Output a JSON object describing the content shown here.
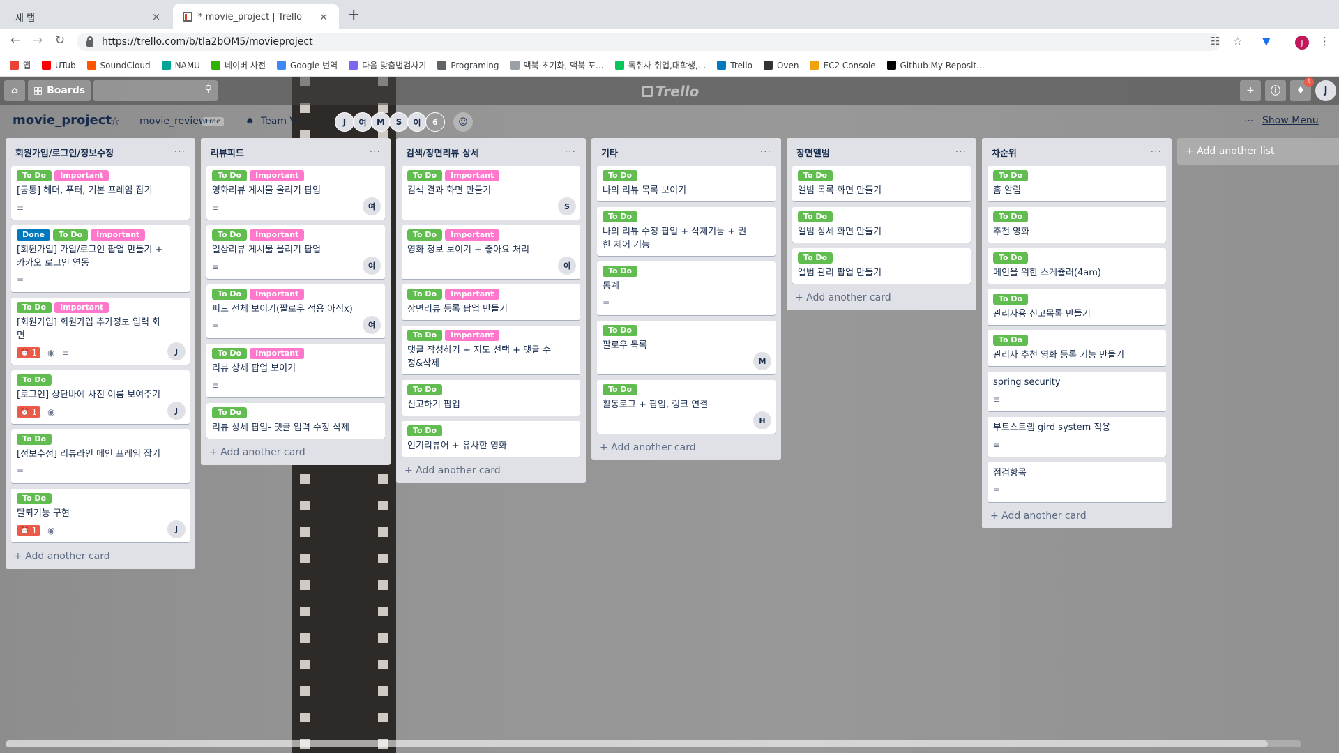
{
  "browser": {
    "tabs": [
      {
        "title": "새 탭",
        "close": "×"
      },
      {
        "title": "* movie_project | Trello",
        "close": "×"
      }
    ],
    "new_tab": "+",
    "url": "https://trello.com/b/tla2bOM5/movieproject",
    "profile": "J",
    "bookmarks": [
      {
        "label": "앱",
        "color": "#ea4335"
      },
      {
        "label": "UTub",
        "color": "#ff0000"
      },
      {
        "label": "SoundCloud",
        "color": "#ff5500"
      },
      {
        "label": "NAMU",
        "color": "#00a495"
      },
      {
        "label": "네이버 사전",
        "color": "#2db400"
      },
      {
        "label": "Google 번역",
        "color": "#4285f4"
      },
      {
        "label": "다음 맞춤법검사기",
        "color": "#7b68ee"
      },
      {
        "label": "Programing",
        "color": "#5f6368"
      },
      {
        "label": "맥북 초기화, 맥북 포...",
        "color": "#9aa0a6"
      },
      {
        "label": "독취사-취업,대학생,...",
        "color": "#03c75a"
      },
      {
        "label": "Trello",
        "color": "#0079bf"
      },
      {
        "label": "Oven",
        "color": "#333333"
      },
      {
        "label": "EC2 Console",
        "color": "#f0a20b"
      },
      {
        "label": "Github My Reposit...",
        "color": "#000000"
      }
    ]
  },
  "topbar": {
    "boards_label": "Boards",
    "logo": "Trello",
    "notification_count": "4",
    "avatar": "J"
  },
  "board": {
    "title": "movie_project",
    "team": "movie_review",
    "plan": "Free",
    "team_visibility": "Team V",
    "members": [
      "J",
      "여",
      "M",
      "S",
      "이"
    ],
    "more_members": "6",
    "show_menu": "Show Menu"
  },
  "add_card_label": "+ Add another card",
  "add_list_label": "+ Add another list",
  "lists": [
    {
      "title": "회원가입/로그인/정보수정",
      "cards": [
        {
          "labels": [
            {
              "t": "To Do",
              "c": "todo"
            },
            {
              "t": "Important",
              "c": "imp"
            }
          ],
          "title": "[공통] 헤더, 푸터, 기본 프레임 잡기",
          "desc": true
        },
        {
          "labels": [
            {
              "t": "Done",
              "c": "done"
            },
            {
              "t": "To Do",
              "c": "todo"
            },
            {
              "t": "Important",
              "c": "imp"
            }
          ],
          "title": "[회원가입] 가입/로그인 팝업 만들기 + 카카오 로그인 연동",
          "desc": true
        },
        {
          "labels": [
            {
              "t": "To Do",
              "c": "todo"
            },
            {
              "t": "Important",
              "c": "imp"
            }
          ],
          "title": "[회원가입] 회원가입 추가정보 입력 화면",
          "due": "1",
          "watch": true,
          "desc": true,
          "member": "J"
        },
        {
          "labels": [
            {
              "t": "To Do",
              "c": "todo"
            }
          ],
          "title": "[로그인] 상단바에 사진 이름 보여주기",
          "due": "1",
          "watch": true,
          "member": "J"
        },
        {
          "labels": [
            {
              "t": "To Do",
              "c": "todo"
            }
          ],
          "title": "[정보수정] 리뷰라인 메인 프레임 잡기",
          "desc": true
        },
        {
          "labels": [
            {
              "t": "To Do",
              "c": "todo"
            }
          ],
          "title": "탈퇴기능 구현",
          "due": "1",
          "watch": true,
          "member": "J"
        }
      ]
    },
    {
      "title": "리뷰피드",
      "cards": [
        {
          "labels": [
            {
              "t": "To Do",
              "c": "todo"
            },
            {
              "t": "Important",
              "c": "imp"
            }
          ],
          "title": "영화리뷰 게시물 올리기 팝업",
          "desc": true,
          "member": "여"
        },
        {
          "labels": [
            {
              "t": "To Do",
              "c": "todo"
            },
            {
              "t": "Important",
              "c": "imp"
            }
          ],
          "title": "일상리뷰 게시물 올리기 팝업",
          "desc": true,
          "member": "여"
        },
        {
          "labels": [
            {
              "t": "To Do",
              "c": "todo"
            },
            {
              "t": "Important",
              "c": "imp"
            }
          ],
          "title": "피드 전체 보이기(팔로우 적용 아직x)",
          "desc": true,
          "member": "여"
        },
        {
          "labels": [
            {
              "t": "To Do",
              "c": "todo"
            },
            {
              "t": "Important",
              "c": "imp"
            }
          ],
          "title": "리뷰 상세 팝업 보이기",
          "desc": true
        },
        {
          "labels": [
            {
              "t": "To Do",
              "c": "todo"
            }
          ],
          "title": "리뷰 상세 팝업- 댓글 입력 수정 삭제"
        }
      ]
    },
    {
      "title": "검색/장면리뷰 상세",
      "cards": [
        {
          "labels": [
            {
              "t": "To Do",
              "c": "todo"
            },
            {
              "t": "Important",
              "c": "imp"
            }
          ],
          "title": "검색 결과 화면 만들기",
          "member": "S",
          "spacer": true
        },
        {
          "labels": [
            {
              "t": "To Do",
              "c": "todo"
            },
            {
              "t": "Important",
              "c": "imp"
            }
          ],
          "title": "영화 정보 보이기 + 좋아요 처리",
          "member": "이",
          "spacer": true
        },
        {
          "labels": [
            {
              "t": "To Do",
              "c": "todo"
            },
            {
              "t": "Important",
              "c": "imp"
            }
          ],
          "title": "장면리뷰 등록 팝업 만들기"
        },
        {
          "labels": [
            {
              "t": "To Do",
              "c": "todo"
            },
            {
              "t": "Important",
              "c": "imp"
            }
          ],
          "title": "댓글 작성하기 + 지도 선택 + 댓글 수정&삭제"
        },
        {
          "labels": [
            {
              "t": "To Do",
              "c": "todo"
            }
          ],
          "title": "신고하기 팝업"
        },
        {
          "labels": [
            {
              "t": "To Do",
              "c": "todo"
            }
          ],
          "title": "인기리뷰어 + 유사한 영화"
        }
      ]
    },
    {
      "title": "기타",
      "cards": [
        {
          "labels": [
            {
              "t": "To Do",
              "c": "todo"
            }
          ],
          "title": "나의 리뷰 목록 보이기"
        },
        {
          "labels": [
            {
              "t": "To Do",
              "c": "todo"
            }
          ],
          "title": "나의 리뷰 수정 팝업 + 삭제기능 + 권한 제어 기능"
        },
        {
          "labels": [
            {
              "t": "To Do",
              "c": "todo"
            }
          ],
          "title": "통계",
          "desc": true
        },
        {
          "labels": [
            {
              "t": "To Do",
              "c": "todo"
            }
          ],
          "title": "팔로우 목록",
          "member": "M",
          "spacer": true
        },
        {
          "labels": [
            {
              "t": "To Do",
              "c": "todo"
            }
          ],
          "title": "활동로그 + 팝업, 링크 연결",
          "member": "H",
          "spacer": true
        }
      ]
    },
    {
      "title": "장면앨범",
      "cards": [
        {
          "labels": [
            {
              "t": "To Do",
              "c": "todo"
            }
          ],
          "title": "앨범 목록 화면 만들기"
        },
        {
          "labels": [
            {
              "t": "To Do",
              "c": "todo"
            }
          ],
          "title": "앨범 상세 화면 만들기"
        },
        {
          "labels": [
            {
              "t": "To Do",
              "c": "todo"
            }
          ],
          "title": "앨범 관리 팝업 만들기"
        }
      ]
    },
    {
      "title": "차순위",
      "cards": [
        {
          "labels": [
            {
              "t": "To Do",
              "c": "todo"
            }
          ],
          "title": "홈 알림"
        },
        {
          "labels": [
            {
              "t": "To Do",
              "c": "todo"
            }
          ],
          "title": "추천 영화"
        },
        {
          "labels": [
            {
              "t": "To Do",
              "c": "todo"
            }
          ],
          "title": "메인을 위한 스케쥴러(4am)"
        },
        {
          "labels": [
            {
              "t": "To Do",
              "c": "todo"
            }
          ],
          "title": "관리자용 신고목록 만들기"
        },
        {
          "labels": [
            {
              "t": "To Do",
              "c": "todo"
            }
          ],
          "title": "관리자 추천 영화 등록 기능 만들기"
        },
        {
          "labels": [],
          "title": "spring security",
          "desc": true
        },
        {
          "labels": [],
          "title": "부트스트랩 gird system 적용",
          "desc": true
        },
        {
          "labels": [],
          "title": "점검항목",
          "desc": true
        }
      ]
    }
  ]
}
